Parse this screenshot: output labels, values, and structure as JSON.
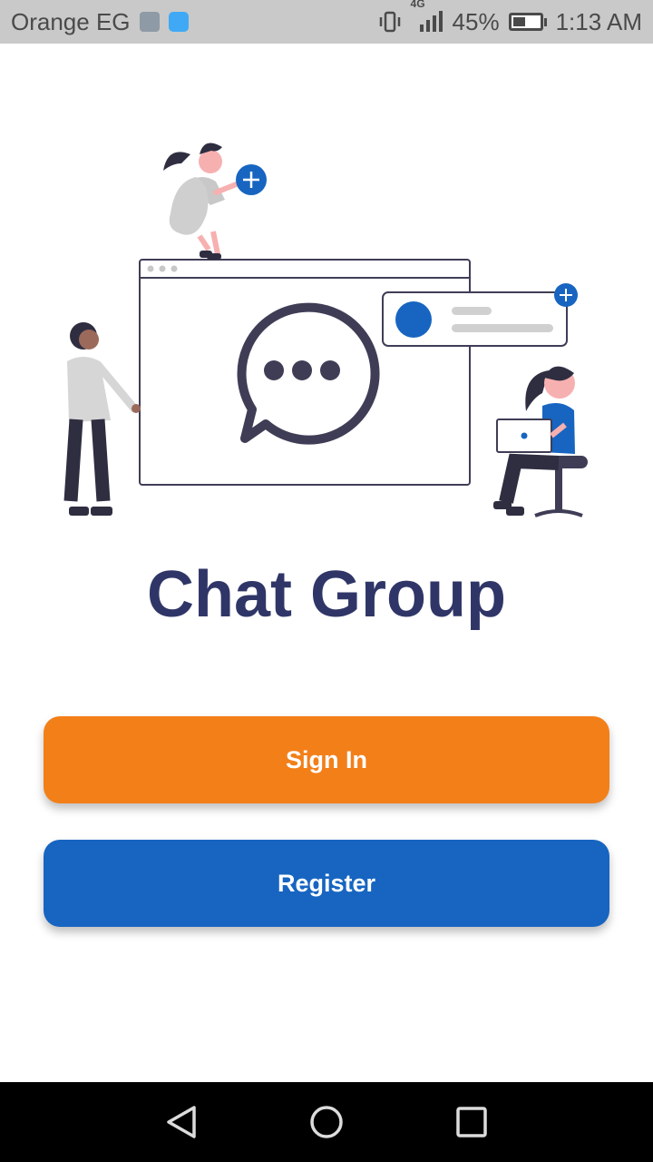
{
  "status_bar": {
    "carrier": "Orange EG",
    "network": "4G",
    "battery_percent": "45%",
    "battery_level": 0.45,
    "time": "1:13 AM",
    "icons": [
      "image-notification-icon",
      "message-notification-icon",
      "vibrate-icon",
      "signal-icon",
      "battery-icon"
    ]
  },
  "app": {
    "title": "Chat Group",
    "sign_in_label": "Sign In",
    "register_label": "Register"
  },
  "colors": {
    "title": "#2f3667",
    "sign_in": "#f37f19",
    "register": "#1765c1",
    "accent": "#1765c1"
  },
  "nav_bar": {
    "icons": [
      "back-icon",
      "home-icon",
      "recents-icon"
    ]
  }
}
